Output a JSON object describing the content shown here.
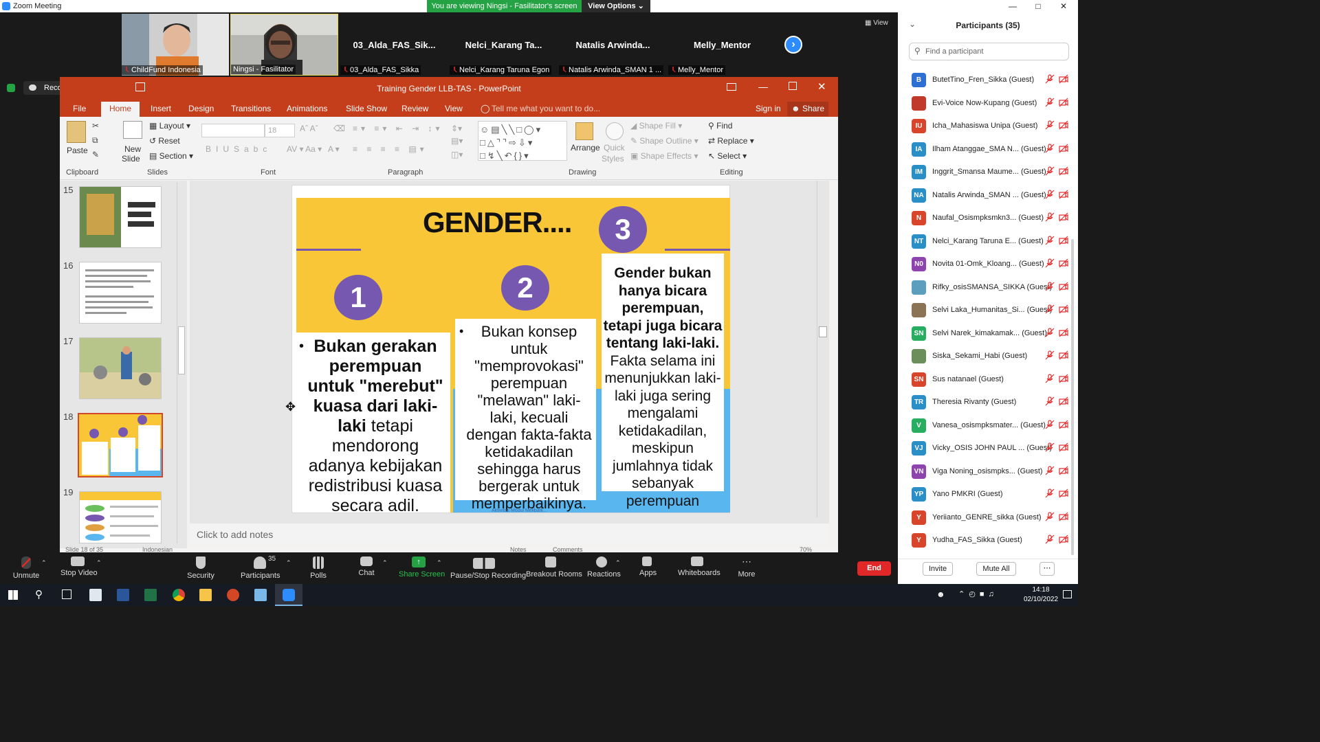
{
  "window": {
    "title": "Zoom Meeting"
  },
  "banner": {
    "viewing": "You are viewing Ningsi - Fasilitator's screen",
    "view_options": "View Options ⌄"
  },
  "strip": {
    "view_label": "View",
    "tiles": [
      {
        "name": "ChildFund Indonesia"
      },
      {
        "name": "Ningsi - Fasilitator"
      },
      {
        "big": "03_Alda_FAS_Sik...",
        "name": "03_Alda_FAS_Sikka"
      },
      {
        "big": "Nelci_Karang  Ta...",
        "name": "Nelci_Karang Taruna Egon"
      },
      {
        "big": "Natalis  Arwinda...",
        "name": "Natalis Arwinda_SMAN 1 ..."
      },
      {
        "big": "Melly_Mentor",
        "name": "Melly_Mentor"
      }
    ]
  },
  "recording": {
    "label": "Recording..."
  },
  "ppt": {
    "title": "Training Gender LLB-TAS  -  PowerPoint",
    "tabs": [
      "File",
      "Home",
      "Insert",
      "Design",
      "Transitions",
      "Animations",
      "Slide Show",
      "Review",
      "View"
    ],
    "tellme": "Tell me what you want to do...",
    "signin": "Sign in",
    "share": "Share",
    "ribbon": {
      "paste": "Paste",
      "new_slide": "New",
      "new_slide2": "Slide",
      "layout": "Layout",
      "reset": "Reset",
      "section": "Section",
      "font_size": "18",
      "arrange": "Arrange",
      "quick_styles": "Quick",
      "quick_styles2": "Styles",
      "shape_fill": "Shape Fill",
      "shape_outline": "Shape Outline",
      "shape_effects": "Shape Effects",
      "find": "Find",
      "replace": "Replace",
      "select": "Select",
      "groups": [
        "Clipboard",
        "Slides",
        "Font",
        "Paragraph",
        "Drawing",
        "Editing"
      ]
    },
    "thumbnails": [
      "15",
      "16",
      "17",
      "18",
      "19"
    ],
    "notes_placeholder": "Click to add notes",
    "status": {
      "slide": "Slide 18 of 35",
      "lang": "Indonesian",
      "notes": "Notes",
      "comments": "Comments",
      "zoom": "70%"
    }
  },
  "slide": {
    "title": "GENDER....",
    "n1": "1",
    "n2": "2",
    "n3": "3",
    "box1_bold": "Bukan gerakan perempuan  untuk \"merebut\" kuasa dari laki-laki",
    "box1_rest": " tetapi mendorong adanya kebijakan redistribusi kuasa secara adil.",
    "box2": "Bukan konsep untuk \"memprovokasi\" perempuan \"melawan\" laki-laki, kecuali dengan fakta-fakta ketidakadilan sehingga harus bergerak untuk memperbaikinya.",
    "box3_bold": "Gender bukan hanya bicara perempuan, tetapi juga bicara tentang laki-laki.",
    "box3_rest": " Fakta selama ini menunjukkan laki-laki juga sering mengalami ketidakadilan, meskipun jumlahnya tidak sebanyak perempuan",
    "footer": "Aktivitas Modul Melibatk..."
  },
  "participants": {
    "header": "Participants (35)",
    "search_placeholder": "Find a participant",
    "list": [
      {
        "initials": "B",
        "color": "#2d6fd2",
        "name": "ButetTino_Fren_Sikka (Guest)"
      },
      {
        "initials": "",
        "color": "#c0392b",
        "name": "Evi-Voice Now-Kupang (Guest)"
      },
      {
        "initials": "IU",
        "color": "#d9452b",
        "name": "Icha_Mahasiswa Unipa (Guest)"
      },
      {
        "initials": "IA",
        "color": "#2a8fc7",
        "name": "Ilham Atanggae_SMA N... (Guest)"
      },
      {
        "initials": "IM",
        "color": "#2a8fc7",
        "name": "Inggrit_Smansa Maume... (Guest)"
      },
      {
        "initials": "NA",
        "color": "#2a8fc7",
        "name": "Natalis Arwinda_SMAN ... (Guest)"
      },
      {
        "initials": "N",
        "color": "#d9452b",
        "name": "Naufal_Osismpksmkn3... (Guest)"
      },
      {
        "initials": "NT",
        "color": "#2a8fc7",
        "name": "Nelci_Karang Taruna E... (Guest)"
      },
      {
        "initials": "N0",
        "color": "#8e44ad",
        "name": "Novita 01-Omk_Kloang... (Guest)"
      },
      {
        "initials": "",
        "color": "#5c9ebd",
        "name": "Rifky_osisSMANSA_SIKKA (Guest)"
      },
      {
        "initials": "",
        "color": "#8b7355",
        "name": "Selvi Laka_Humanitas_Si... (Guest)"
      },
      {
        "initials": "SN",
        "color": "#27ae60",
        "name": "Selvi Narek_kimakamak... (Guest)"
      },
      {
        "initials": "",
        "color": "#6b8e5a",
        "name": "Siska_Sekami_Habi (Guest)"
      },
      {
        "initials": "SN",
        "color": "#d9452b",
        "name": "Sus natanael (Guest)"
      },
      {
        "initials": "TR",
        "color": "#2a8fc7",
        "name": "Theresia Rivanty (Guest)"
      },
      {
        "initials": "V",
        "color": "#27ae60",
        "name": "Vanesa_osismpksmater... (Guest)"
      },
      {
        "initials": "VJ",
        "color": "#2a8fc7",
        "name": "Vicky_OSIS JOHN PAUL ... (Guest)"
      },
      {
        "initials": "VN",
        "color": "#8e44ad",
        "name": "Viga Noning_osismpks... (Guest)"
      },
      {
        "initials": "YP",
        "color": "#2a8fc7",
        "name": "Yano PMKRI (Guest)"
      },
      {
        "initials": "Y",
        "color": "#d9452b",
        "name": "Yeriianto_GENRE_sikka (Guest)"
      },
      {
        "initials": "Y",
        "color": "#d9452b",
        "name": "Yudha_FAS_Sikka (Guest)"
      }
    ],
    "invite": "Invite",
    "mute_all": "Mute All"
  },
  "toolbar": {
    "unmute": "Unmute",
    "stop_video": "Stop Video",
    "security": "Security",
    "participants": "Participants",
    "participants_count": "35",
    "polls": "Polls",
    "chat": "Chat",
    "share_screen": "Share Screen",
    "recording": "Pause/Stop Recording",
    "breakout": "Breakout Rooms",
    "reactions": "Reactions",
    "apps": "Apps",
    "whiteboards": "Whiteboards",
    "more": "More",
    "end": "End"
  },
  "taskbar": {
    "time": "14:18",
    "date": "02/10/2022"
  }
}
